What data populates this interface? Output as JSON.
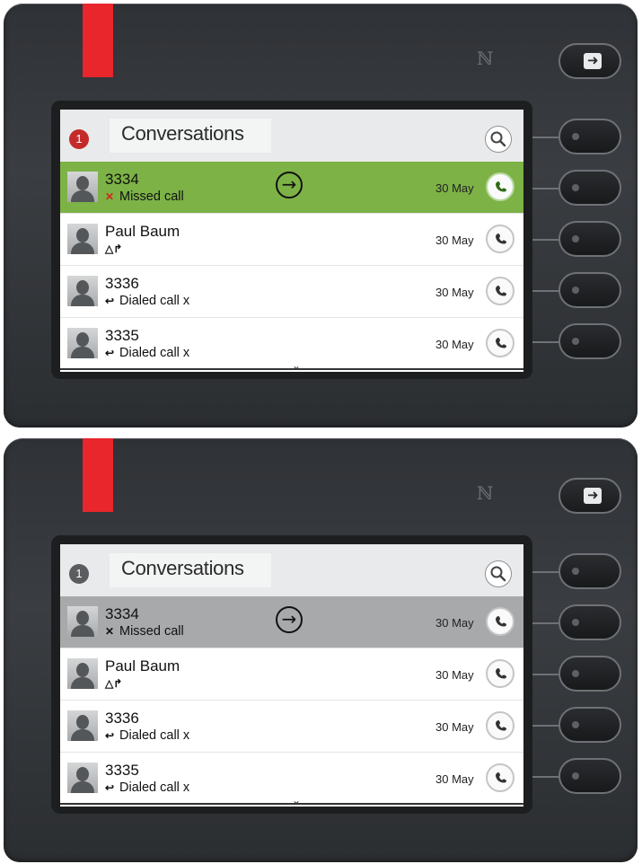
{
  "panels": [
    {
      "variant": "active",
      "header": {
        "title": "Conversations",
        "badge": "1",
        "badge_color": "#c42a2a"
      },
      "rows": [
        {
          "name": "3334",
          "sub": "Missed call",
          "sub_icon": "missed-call-icon",
          "date": "30 May",
          "selected": true
        },
        {
          "name": "Paul Baum",
          "sub": "",
          "sub_icon": "forward-icon",
          "date": "30 May",
          "selected": false
        },
        {
          "name": "3336",
          "sub": "Dialed call x",
          "sub_icon": "dialed-call-icon",
          "date": "30 May",
          "selected": false
        },
        {
          "name": "3335",
          "sub": "Dialed call x",
          "sub_icon": "dialed-call-icon",
          "date": "30 May",
          "selected": false
        }
      ]
    },
    {
      "variant": "inactive",
      "header": {
        "title": "Conversations",
        "badge": "1",
        "badge_color": "#5a5c5f"
      },
      "rows": [
        {
          "name": "3334",
          "sub": "Missed call",
          "sub_icon": "missed-call-icon",
          "date": "30 May",
          "selected": true
        },
        {
          "name": "Paul Baum",
          "sub": "",
          "sub_icon": "forward-icon",
          "date": "30 May",
          "selected": false
        },
        {
          "name": "3336",
          "sub": "Dialed call x",
          "sub_icon": "dialed-call-icon",
          "date": "30 May",
          "selected": false
        },
        {
          "name": "3335",
          "sub": "Dialed call x",
          "sub_icon": "dialed-call-icon",
          "date": "30 May",
          "selected": false
        }
      ]
    }
  ],
  "colors": {
    "selected_green": "#7db246",
    "selected_grey": "#a7a9ab",
    "led_red": "#e8262c",
    "missed_red": "#d3261f"
  }
}
